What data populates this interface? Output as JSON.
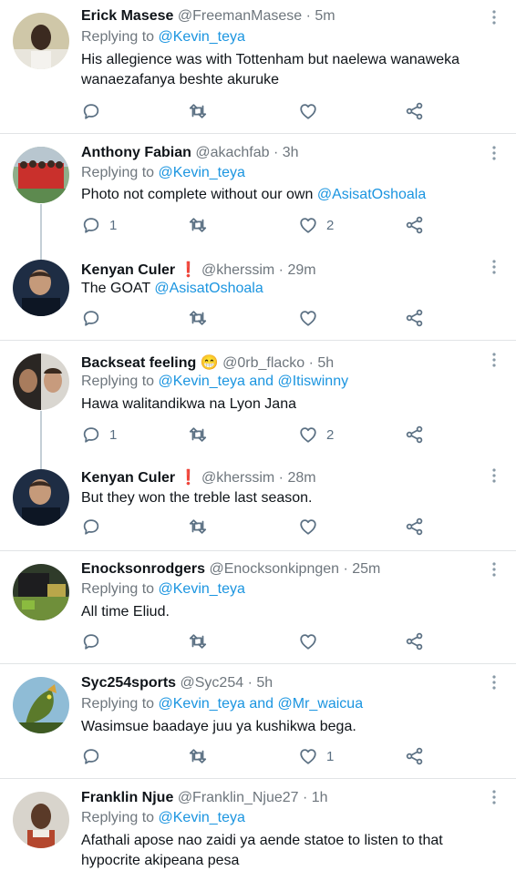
{
  "tweets": [
    {
      "name": "Erick Masese",
      "handle": "@FreemanMasese · 5m",
      "replying_prefix": "Replying to",
      "replying_to": "@Kevin_teya",
      "text_line1": "His allegience was with Tottenham but naelewa wanaweka",
      "text_line2": "wanaezafanya beshte akuruke",
      "replies": "",
      "likes": ""
    },
    {
      "name": "Anthony Fabian",
      "handle": "@akachfab · 3h",
      "replying_prefix": "Replying to",
      "replying_to": "@Kevin_teya",
      "text": "Photo not complete without our own",
      "mention": "@AsisatOshoala",
      "replies": "1",
      "likes": "2"
    },
    {
      "name": "Kenyan Culer",
      "badge": "❗",
      "handle": "@kherssim · 29m",
      "text": "The GOAT",
      "mention": "@AsisatOshoala",
      "replies": "",
      "likes": ""
    },
    {
      "name": "Backseat feeling",
      "badge": "😁",
      "handle": "@0rb_flacko · 5h",
      "replying_prefix": "Replying to",
      "replying_to": "@Kevin_teya and @Itiswinny",
      "text": "Hawa walitandikwa na Lyon Jana",
      "replies": "1",
      "likes": "2"
    },
    {
      "name": "Kenyan Culer",
      "badge": "❗",
      "handle": "@kherssim · 28m",
      "text": "But they won the treble last season.",
      "replies": "",
      "likes": ""
    },
    {
      "name": "Enocksonrodgers",
      "handle": "@Enocksonkipngen · 25m",
      "replying_prefix": "Replying to",
      "replying_to": "@Kevin_teya",
      "text": "All time Eliud.",
      "replies": "",
      "likes": ""
    },
    {
      "name": "Syc254sports",
      "handle": "@Syc254 · 5h",
      "replying_prefix": "Replying to",
      "replying_to": "@Kevin_teya and @Mr_waicua",
      "text": "Wasimsue baadaye juu ya kushikwa bega.",
      "replies": "",
      "likes": "1"
    },
    {
      "name": "Franklin Njue",
      "handle": "@Franklin_Njue27 · 1h",
      "replying_prefix": "Replying to",
      "replying_to": "@Kevin_teya",
      "text_line1": "Afathali apose nao zaidi ya aende statoe to listen to that",
      "text_line2": "hypocrite akipeana pesa"
    }
  ],
  "icons": [
    "reply-icon",
    "retweet-icon",
    "like-icon",
    "share-icon",
    "more-icon"
  ],
  "colors": {
    "link": "#1b95e0",
    "muted": "#6e767d",
    "icon": "#5b7083",
    "divider": "#e1e4e6"
  }
}
